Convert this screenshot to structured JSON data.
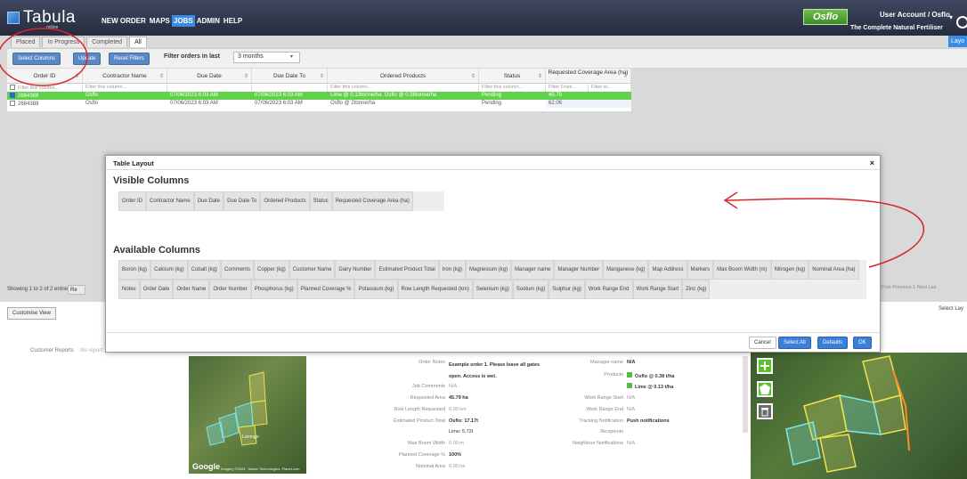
{
  "app": {
    "logo_text": "Tabula",
    "logo_sub": "online",
    "nav": [
      "NEW ORDER",
      "MAPS",
      "JOBS",
      "ADMIN",
      "HELP"
    ],
    "active_nav": "JOBS",
    "brand_logo": "Osflo",
    "brand_tagline": "The Complete Natural Fertiliser",
    "account": "User Account / Osflo",
    "account_caret": "▾"
  },
  "tabs": [
    "Placed",
    "In Progress",
    "Completed",
    "All"
  ],
  "active_tab": "All",
  "layout_button": "Layo",
  "toolbar": {
    "select_columns": "Select Columns",
    "update": "Update",
    "reset_filters": "Reset Filters",
    "filter_label": "Filter orders in last",
    "filter_value": "3 months"
  },
  "table": {
    "columns": [
      "Order ID",
      "Contractor Name",
      "Due Date",
      "Due Date To",
      "Ordered Products",
      "Status",
      "Requested Coverage Area (ha)"
    ],
    "filters": [
      "Filter this column...",
      "Filter this column...",
      "",
      "",
      "Filter this column...",
      "Filter this column...",
      "Filter From...",
      "Filter to..."
    ],
    "rows": [
      {
        "id": "2684388",
        "contractor": "Osflo",
        "due": "07/06/2023 6:03 AM",
        "due_to": "07/06/2023 6:03 AM",
        "products": "Lime @ 0.13tonne/ha, Osflo @ 0.38tonne/ha",
        "status": "Pending",
        "area": "45.79"
      },
      {
        "id": "2684389",
        "contractor": "Osflo",
        "due": "07/06/2023 6:03 AM",
        "due_to": "07/06/2023 6:03 AM",
        "products": "Osflo @ 2tonne/ha",
        "status": "Pending",
        "area": "62.06"
      }
    ]
  },
  "footer": {
    "showing": "Showing 1 to 2 of 2 entries",
    "showing_btn": "Re",
    "paging": "First  Previous  1  Next  Las",
    "customise": "Customise View",
    "select_layer": "Select Lay",
    "customer_reports": "Customer Reports",
    "no_reports": "No report"
  },
  "details": {
    "labels": [
      "Order Notes",
      "Job Comments",
      "Requested Area",
      "Row Length Requested",
      "Estimated Product Total",
      "Max Boom Width",
      "Planned Coverage %",
      "Nominal Area"
    ],
    "values": [
      "Example order 1. Please leave all gates open. Access is wet.",
      "N/A",
      "45.79 ha",
      "0.00 km",
      "Osflo: 17.17t",
      "Lime: 5.72t",
      "0.00 m",
      "100%",
      "0.00 ha"
    ],
    "right_labels": [
      "Manager name",
      "Products",
      "Work Range Start",
      "Work Range End",
      "Tracking Notification",
      "Recipients",
      "Neighbour Notifications"
    ],
    "right_values": [
      "N/A",
      "Osflo @ 0.38 t/ha",
      "Lime @ 0.13 t/ha",
      "N/A",
      "N/A",
      "Push notifications",
      "N/A"
    ],
    "map_google": "Google",
    "map_attr": "Imagery ©2023 , Maxar Technologies, Planet.com",
    "map_place": "Lurongo"
  },
  "modal": {
    "title": "Table Layout",
    "close": "×",
    "visible_title": "Visible Columns",
    "visible": [
      "Order ID",
      "Contractor Name",
      "Due Date",
      "Due Date To",
      "Ordered Products",
      "Status",
      "Requested Coverage Area (ha)"
    ],
    "available_title": "Available Columns",
    "available": [
      "Boron (kg)",
      "Calcium (kg)",
      "Cobalt (kg)",
      "Comments",
      "Copper (kg)",
      "Customer Name",
      "Dairy Number",
      "Estimated Product Total",
      "Iron (kg)",
      "Magnesium (kg)",
      "Manager name",
      "Manager Number",
      "Manganese (kg)",
      "Map Address",
      "Markers",
      "Max Boom Width (m)",
      "Nitrogen (kg)",
      "Nominal Area (ha)",
      "Notes",
      "Order Date",
      "Order Name",
      "Order Number",
      "Phosphorus (kg)",
      "Planned Coverage %",
      "Potassium (kg)",
      "Row Length Requested (km)",
      "Selenium (kg)",
      "Sodium (kg)",
      "Sulphur (kg)",
      "Work Range End",
      "Work Range Start",
      "Zinc (kg)"
    ],
    "buttons": {
      "cancel": "Cancel",
      "select_all": "Select All",
      "defaults": "Defaults",
      "ok": "OK"
    }
  },
  "colors": {
    "highlight_row": "#61d04b",
    "accent": "#3b7fd6",
    "annotation": "#d8262b"
  }
}
